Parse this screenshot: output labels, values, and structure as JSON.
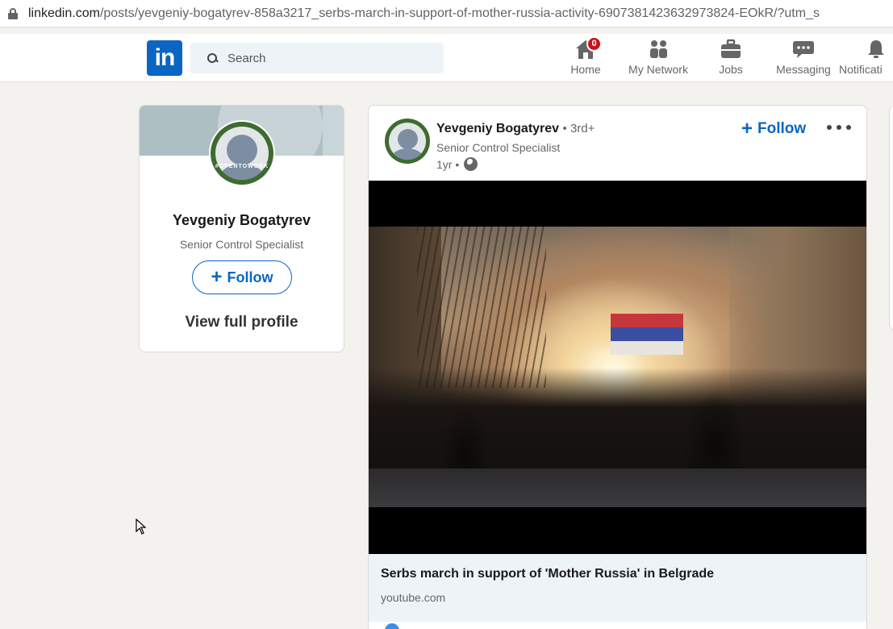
{
  "browser": {
    "url_host": "linkedin.com",
    "url_rest": "/posts/yevgeniy-bogatyrev-858a3217_serbs-march-in-support-of-mother-russia-activity-6907381423632973824-EOkR/?utm_s"
  },
  "nav": {
    "logo": "in",
    "search_placeholder": "Search",
    "items": [
      {
        "label": "Home",
        "icon": "home-icon",
        "badge": "0"
      },
      {
        "label": "My Network",
        "icon": "network-icon"
      },
      {
        "label": "Jobs",
        "icon": "briefcase-icon"
      },
      {
        "label": "Messaging",
        "icon": "messaging-icon"
      },
      {
        "label": "Notificati",
        "icon": "bell-icon"
      }
    ],
    "brand_color": "#0a66c2",
    "badge_color": "#cc1016"
  },
  "profile": {
    "name": "Yevgeniy Bogatyrev",
    "title": "Senior Control Specialist",
    "ring_text": "#OPENTOWORK",
    "follow_label": "Follow",
    "view_profile_label": "View full profile"
  },
  "post": {
    "author": "Yevgeniy Bogatyrev",
    "degree": "• 3rd+",
    "author_title": "Senior Control Specialist",
    "age": "1yr •",
    "follow_label": "Follow",
    "link_title": "Serbs march in support of 'Mother Russia' in Belgrade",
    "link_domain": "youtube.com"
  }
}
